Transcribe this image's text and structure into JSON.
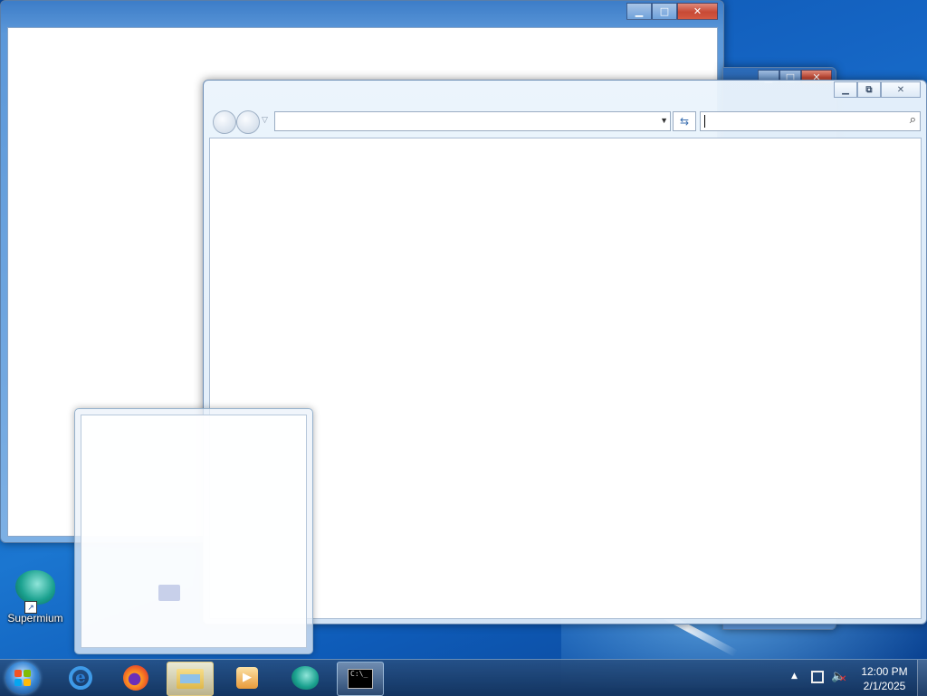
{
  "desktop": {
    "icons": [
      {
        "label": "Supermium"
      }
    ]
  },
  "windows": {
    "back_window": {
      "caption_buttons": [
        "minimize",
        "maximize",
        "close"
      ]
    },
    "middle_window": {
      "caption_buttons": [
        "minimize",
        "maximize",
        "close"
      ]
    },
    "explorer_window": {
      "caption_buttons": [
        "minimize",
        "restore",
        "close"
      ],
      "address_value": "",
      "search_value": ""
    }
  },
  "taskbar": {
    "buttons": [
      "start",
      "internet-explorer",
      "firefox",
      "file-explorer",
      "media-player",
      "supermium",
      "command-prompt"
    ],
    "clock": {
      "time": "12:00 PM",
      "date": "2/1/2025"
    },
    "tray_icons": [
      "show-hidden-icons",
      "network-icon",
      "volume-muted-icon"
    ]
  },
  "colors": {
    "desktop_background": "#1565c4",
    "taskbar": "#1e3f66",
    "close_button": "#c74935"
  }
}
